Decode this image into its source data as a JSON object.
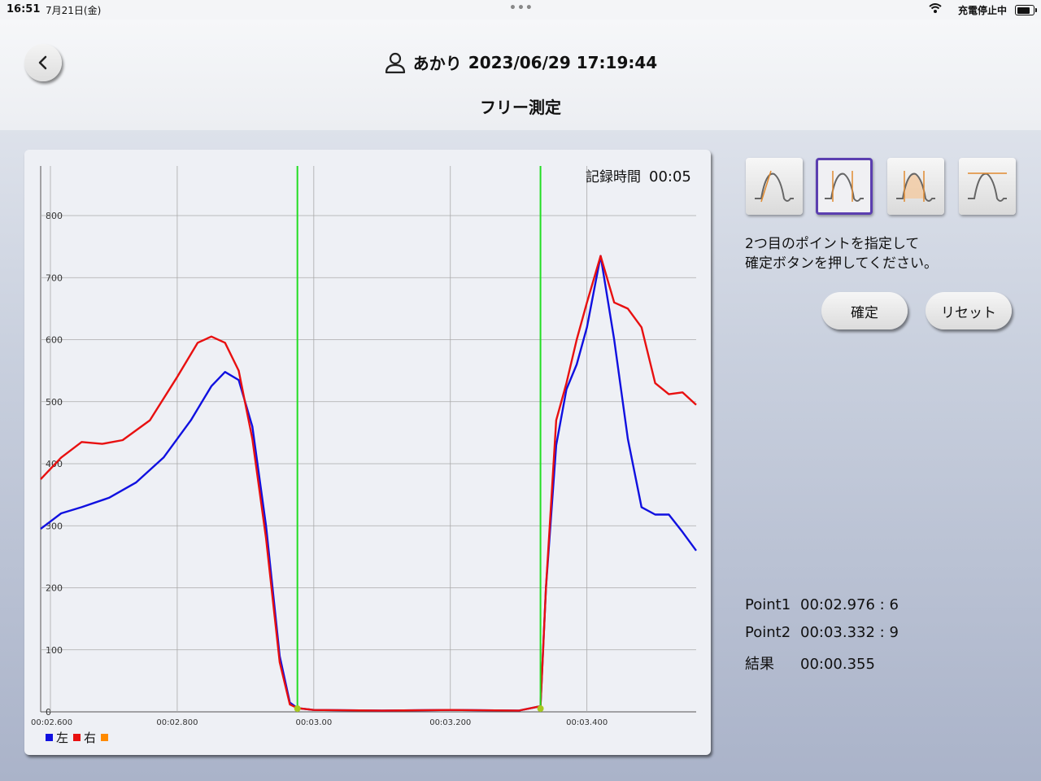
{
  "status_bar": {
    "time": "16:51",
    "date": "7月21日(金)",
    "charging_text": "充電停止中",
    "battery_level": 0.9
  },
  "header": {
    "user_name": "あかり",
    "datetime": "2023/06/29 17:19:44",
    "title": "フリー測定"
  },
  "chart": {
    "record_label": "記録時間",
    "record_value": "00:05"
  },
  "chart_data": {
    "type": "line",
    "xlim": [
      2.6,
      3.56
    ],
    "ylim": [
      0,
      880
    ],
    "y_ticks": [
      0,
      100,
      200,
      300,
      400,
      500,
      600,
      700,
      800
    ],
    "x_ticks": [
      {
        "value": 2.6,
        "label": "00:02.600"
      },
      {
        "value": 2.8,
        "label": "00:02.800"
      },
      {
        "value": 3.0,
        "label": "00:03.00"
      },
      {
        "value": 3.2,
        "label": "00:03.200"
      },
      {
        "value": 3.4,
        "label": "00:03.400"
      }
    ],
    "markers": [
      2.976,
      3.332
    ],
    "series": [
      {
        "name": "左",
        "color": "#1010e0",
        "points": [
          [
            2.6,
            295
          ],
          [
            2.63,
            320
          ],
          [
            2.66,
            330
          ],
          [
            2.7,
            345
          ],
          [
            2.74,
            370
          ],
          [
            2.78,
            410
          ],
          [
            2.82,
            470
          ],
          [
            2.85,
            525
          ],
          [
            2.87,
            548
          ],
          [
            2.89,
            535
          ],
          [
            2.91,
            460
          ],
          [
            2.93,
            300
          ],
          [
            2.95,
            90
          ],
          [
            2.965,
            15
          ],
          [
            2.976,
            6
          ],
          [
            3.0,
            3
          ],
          [
            3.1,
            2
          ],
          [
            3.2,
            3
          ],
          [
            3.3,
            2
          ],
          [
            3.332,
            9
          ],
          [
            3.34,
            200
          ],
          [
            3.355,
            430
          ],
          [
            3.37,
            520
          ],
          [
            3.385,
            560
          ],
          [
            3.4,
            620
          ],
          [
            3.42,
            735
          ],
          [
            3.44,
            600
          ],
          [
            3.46,
            440
          ],
          [
            3.48,
            330
          ],
          [
            3.5,
            318
          ],
          [
            3.52,
            318
          ],
          [
            3.54,
            290
          ],
          [
            3.56,
            260
          ]
        ]
      },
      {
        "name": "右",
        "color": "#e81010",
        "points": [
          [
            2.6,
            375
          ],
          [
            2.63,
            410
          ],
          [
            2.66,
            435
          ],
          [
            2.69,
            432
          ],
          [
            2.72,
            438
          ],
          [
            2.76,
            470
          ],
          [
            2.8,
            540
          ],
          [
            2.83,
            595
          ],
          [
            2.85,
            605
          ],
          [
            2.87,
            595
          ],
          [
            2.89,
            550
          ],
          [
            2.91,
            440
          ],
          [
            2.93,
            280
          ],
          [
            2.95,
            80
          ],
          [
            2.965,
            12
          ],
          [
            2.976,
            6
          ],
          [
            3.0,
            3
          ],
          [
            3.1,
            2
          ],
          [
            3.2,
            3
          ],
          [
            3.3,
            2
          ],
          [
            3.332,
            9
          ],
          [
            3.34,
            200
          ],
          [
            3.355,
            470
          ],
          [
            3.37,
            530
          ],
          [
            3.385,
            600
          ],
          [
            3.4,
            660
          ],
          [
            3.42,
            735
          ],
          [
            3.44,
            660
          ],
          [
            3.46,
            650
          ],
          [
            3.48,
            620
          ],
          [
            3.5,
            530
          ],
          [
            3.52,
            512
          ],
          [
            3.54,
            515
          ],
          [
            3.56,
            495
          ]
        ]
      },
      {
        "name": "",
        "color": "#ff8a00",
        "points": []
      }
    ]
  },
  "type_buttons": [
    {
      "icon": "waveform-start-icon",
      "selected": false
    },
    {
      "icon": "waveform-start-end-icon",
      "selected": true
    },
    {
      "icon": "waveform-area-icon",
      "selected": false
    },
    {
      "icon": "waveform-peak-icon",
      "selected": false
    }
  ],
  "instruction": {
    "line1": "2つ目のポイントを指定して",
    "line2": "確定ボタンを押してください。"
  },
  "buttons": {
    "confirm": "確定",
    "reset": "リセット"
  },
  "results": {
    "point1_label": "Point1",
    "point1_value": "00:02.976 : 6",
    "point2_label": "Point2",
    "point2_value": "00:03.332 : 9",
    "result_label": "結果",
    "result_value": "00:00.355"
  },
  "legend": {
    "left": "左",
    "right": "右",
    "left_color": "#1010e0",
    "right_color": "#e81010",
    "third_color": "#ff8a00"
  }
}
